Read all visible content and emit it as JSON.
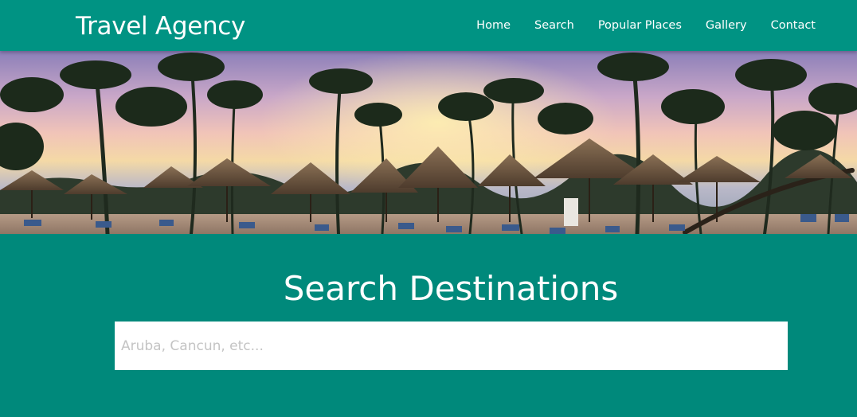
{
  "header": {
    "brand": "Travel Agency",
    "nav": [
      {
        "label": "Home"
      },
      {
        "label": "Search"
      },
      {
        "label": "Popular Places"
      },
      {
        "label": "Gallery"
      },
      {
        "label": "Contact"
      }
    ]
  },
  "search": {
    "title": "Search Destinations",
    "placeholder": "Aruba, Cancun, etc..."
  },
  "colors": {
    "navbar": "#009383",
    "section": "#00897b",
    "text": "#ffffff"
  }
}
